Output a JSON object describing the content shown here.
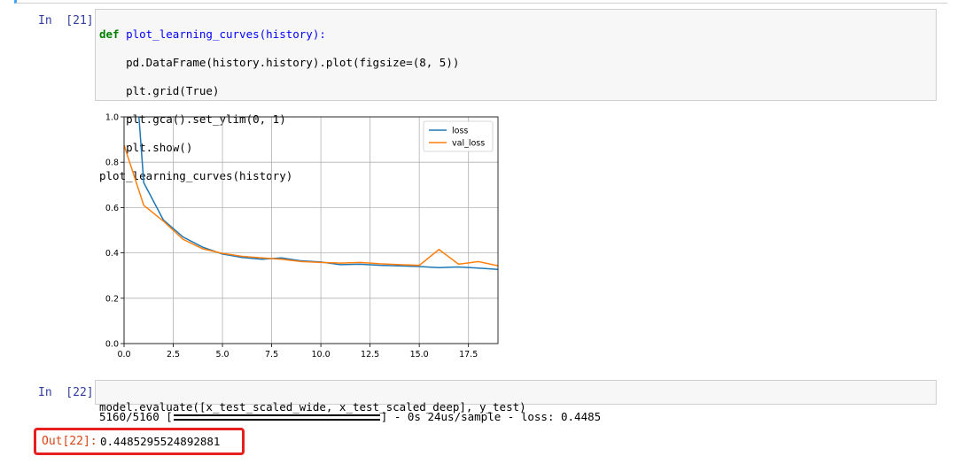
{
  "cells": [
    {
      "prompt": "In  [21]:",
      "code_lines": [
        "def plot_learning_curves(history):",
        "    pd.DataFrame(history.history).plot(figsize=(8, 5))",
        "    plt.grid(True)",
        "    plt.gca().set_ylim(0, 1)",
        "    plt.show()",
        "plot_learning_curves(history)"
      ]
    },
    {
      "prompt": "In  [22]:",
      "code_lines": [
        "model.evaluate([x_test_scaled_wide, x_test_scaled_deep], y_test)"
      ],
      "stdout": {
        "prefix": "5160/5160 [",
        "suffix": "] - 0s 24us/sample - loss: 0.4485"
      },
      "out_prompt": "Out[22]:",
      "out_value": "0.4485295524892881"
    }
  ],
  "chart_data": {
    "type": "line",
    "x": [
      0,
      1,
      2,
      3,
      4,
      5,
      6,
      7,
      8,
      9,
      10,
      11,
      12,
      13,
      14,
      15,
      16,
      17,
      18,
      19
    ],
    "series": [
      {
        "name": "loss",
        "color": "#1f77b4",
        "values": [
          1.9,
          0.71,
          0.545,
          0.47,
          0.425,
          0.395,
          0.38,
          0.372,
          0.378,
          0.365,
          0.36,
          0.348,
          0.35,
          0.345,
          0.343,
          0.34,
          0.335,
          0.338,
          0.333,
          0.327
        ]
      },
      {
        "name": "val_loss",
        "color": "#ff7f0e",
        "values": [
          0.875,
          0.61,
          0.54,
          0.46,
          0.418,
          0.398,
          0.385,
          0.378,
          0.372,
          0.362,
          0.358,
          0.355,
          0.358,
          0.352,
          0.348,
          0.345,
          0.415,
          0.35,
          0.362,
          0.343
        ]
      }
    ],
    "xlim": [
      0,
      19
    ],
    "ylim": [
      0,
      1
    ],
    "xticks": [
      0.0,
      2.5,
      5.0,
      7.5,
      10.0,
      12.5,
      15.0,
      17.5
    ],
    "xtick_labels": [
      "0.0",
      "2.5",
      "5.0",
      "7.5",
      "10.0",
      "12.5",
      "15.0",
      "17.5"
    ],
    "yticks": [
      0.0,
      0.2,
      0.4,
      0.6,
      0.8,
      1.0
    ],
    "ytick_labels": [
      "0.0",
      "0.2",
      "0.4",
      "0.6",
      "0.8",
      "1.0"
    ],
    "grid": true,
    "legend_position": "top-right"
  }
}
